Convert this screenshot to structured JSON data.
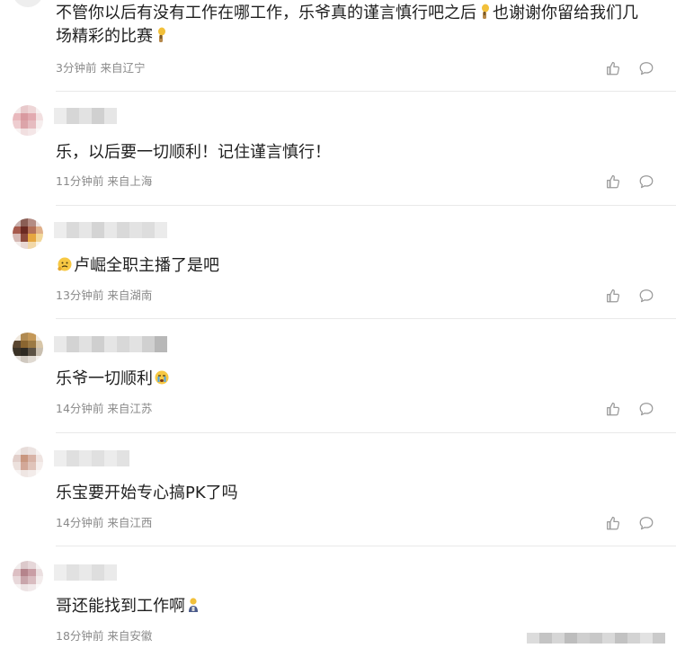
{
  "comments": [
    {
      "text_part1": "不管你以后有没有工作在哪工作，乐爷真的谨言慎行吧之后",
      "text_part2": "也谢谢你留给我们几场精彩的比赛",
      "time": "3分钟前",
      "location": "来自辽宁",
      "emoji_icons": [
        "thumbs-up-emoji-icon",
        "thumbs-up-emoji-icon"
      ]
    },
    {
      "text": "乐，以后要一切顺利！记住谨言慎行！",
      "time": "11分钟前",
      "location": "来自上海"
    },
    {
      "text": "卢崛全职主播了是吧",
      "time": "13分钟前",
      "location": "来自湖南",
      "emoji_icons": [
        "thinking-face-emoji-icon"
      ]
    },
    {
      "text": "乐爷一切顺利",
      "time": "14分钟前",
      "location": "来自江苏",
      "emoji_icons": [
        "crying-face-emoji-icon"
      ]
    },
    {
      "text": "乐宝要开始专心搞PK了吗",
      "time": "14分钟前",
      "location": "来自江西"
    },
    {
      "text": "哥还能找到工作啊",
      "time": "18分钟前",
      "location": "来自安徽",
      "emoji_icons": [
        "person-emoji-icon"
      ]
    }
  ],
  "icons": {
    "like": "thumbs-up-icon",
    "reply": "comment-bubble-icon"
  },
  "colors": {
    "text": "#1f1f1f",
    "meta": "#8a8a8a",
    "icon": "#9a9a9a",
    "divider": "#e9e9e9"
  }
}
